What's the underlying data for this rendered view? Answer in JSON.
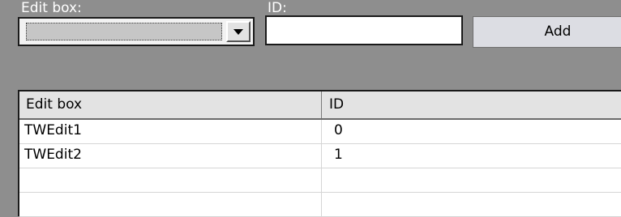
{
  "form": {
    "edit_box_label": "Edit box:",
    "id_label": "ID:",
    "edit_box_value": "",
    "id_value": "",
    "add_label": "Add"
  },
  "table": {
    "columns": [
      "Edit box",
      "ID"
    ],
    "rows": [
      [
        "TWEdit1",
        "0"
      ],
      [
        "TWEdit2",
        "1"
      ],
      [
        "",
        ""
      ],
      [
        "",
        ""
      ]
    ]
  },
  "colors": {
    "background": "#8e8e8e",
    "label_text": "#ffffff"
  }
}
